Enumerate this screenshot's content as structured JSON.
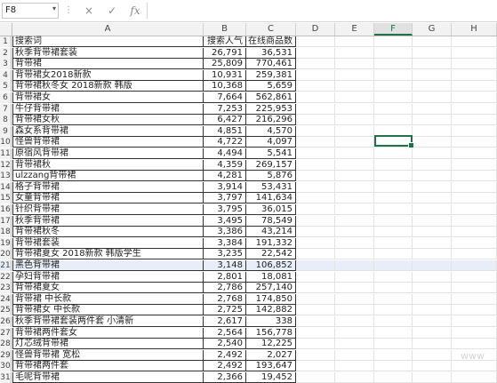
{
  "formula_bar": {
    "name_box": "F8",
    "name_dropdown_icon": "chevron-down-icon",
    "separator": "⋮",
    "cancel_icon": "×",
    "confirm_icon": "✓",
    "function_icon": "fx",
    "formula": ""
  },
  "columns": [
    "A",
    "B",
    "C",
    "D",
    "E",
    "F",
    "G",
    "H"
  ],
  "selected_cell": "F8",
  "rows": [
    {
      "n": "1",
      "a": "搜索词",
      "b": "搜索人气",
      "c": "在线商品数"
    },
    {
      "n": "2",
      "a": "秋季背带裙套装",
      "b": "26,791",
      "c": "36,531"
    },
    {
      "n": "3",
      "a": "背带裙",
      "b": "25,809",
      "c": "770,461"
    },
    {
      "n": "4",
      "a": "背带裙女2018新款",
      "b": "10,931",
      "c": "259,381"
    },
    {
      "n": "5",
      "a": "背带裙秋冬女 2018新款 韩版",
      "b": "10,368",
      "c": "5,659"
    },
    {
      "n": "6",
      "a": "背带裙女",
      "b": "7,664",
      "c": "562,861"
    },
    {
      "n": "7",
      "a": "牛仔背带裙",
      "b": "7,253",
      "c": "225,953"
    },
    {
      "n": "8",
      "a": "背带裙女秋",
      "b": "6,427",
      "c": "216,296"
    },
    {
      "n": "9",
      "a": "森女系背带裙",
      "b": "4,851",
      "c": "4,570"
    },
    {
      "n": "10",
      "a": "怪兽背带裙",
      "b": "4,722",
      "c": "4,097"
    },
    {
      "n": "11",
      "a": "原宿风背带裙",
      "b": "4,494",
      "c": "5,541"
    },
    {
      "n": "12",
      "a": "背带裙秋",
      "b": "4,359",
      "c": "269,157"
    },
    {
      "n": "13",
      "a": "ulzzang背带裙",
      "b": "4,281",
      "c": "5,876"
    },
    {
      "n": "14",
      "a": "格子背带裙",
      "b": "3,914",
      "c": "53,431"
    },
    {
      "n": "15",
      "a": "女童背带裙",
      "b": "3,797",
      "c": "141,634"
    },
    {
      "n": "16",
      "a": "针织背带裙",
      "b": "3,795",
      "c": "36,015"
    },
    {
      "n": "17",
      "a": "秋季背带裙",
      "b": "3,495",
      "c": "78,549"
    },
    {
      "n": "18",
      "a": "背带裙秋冬",
      "b": "3,386",
      "c": "43,214"
    },
    {
      "n": "19",
      "a": "背带裙套装",
      "b": "3,384",
      "c": "191,332"
    },
    {
      "n": "20",
      "a": "背带裙夏女 2018新款 韩版学生",
      "b": "3,235",
      "c": "22,542"
    },
    {
      "n": "21",
      "a": "黑色背带裙",
      "b": "3,148",
      "c": "106,852"
    },
    {
      "n": "22",
      "a": "孕妇背带裙",
      "b": "2,801",
      "c": "18,081"
    },
    {
      "n": "23",
      "a": "背带裙夏女",
      "b": "2,786",
      "c": "257,140"
    },
    {
      "n": "24",
      "a": "背带裙 中长款",
      "b": "2,768",
      "c": "174,850"
    },
    {
      "n": "25",
      "a": "背带裙女 中长款",
      "b": "2,725",
      "c": "142,882"
    },
    {
      "n": "26",
      "a": "秋季背带裙套装两件套 小清新",
      "b": "2,617",
      "c": "338"
    },
    {
      "n": "27",
      "a": "背带裙两件套女",
      "b": "2,564",
      "c": "156,778"
    },
    {
      "n": "28",
      "a": "灯芯绒背带裙",
      "b": "2,540",
      "c": "12,225"
    },
    {
      "n": "29",
      "a": "怪兽背带裙 宽松",
      "b": "2,492",
      "c": "2,027"
    },
    {
      "n": "30",
      "a": "背带裙两件套",
      "b": "2,492",
      "c": "193,647"
    },
    {
      "n": "31",
      "a": "毛呢背带裙",
      "b": "2,366",
      "c": "19,452"
    }
  ],
  "watermark": "www"
}
